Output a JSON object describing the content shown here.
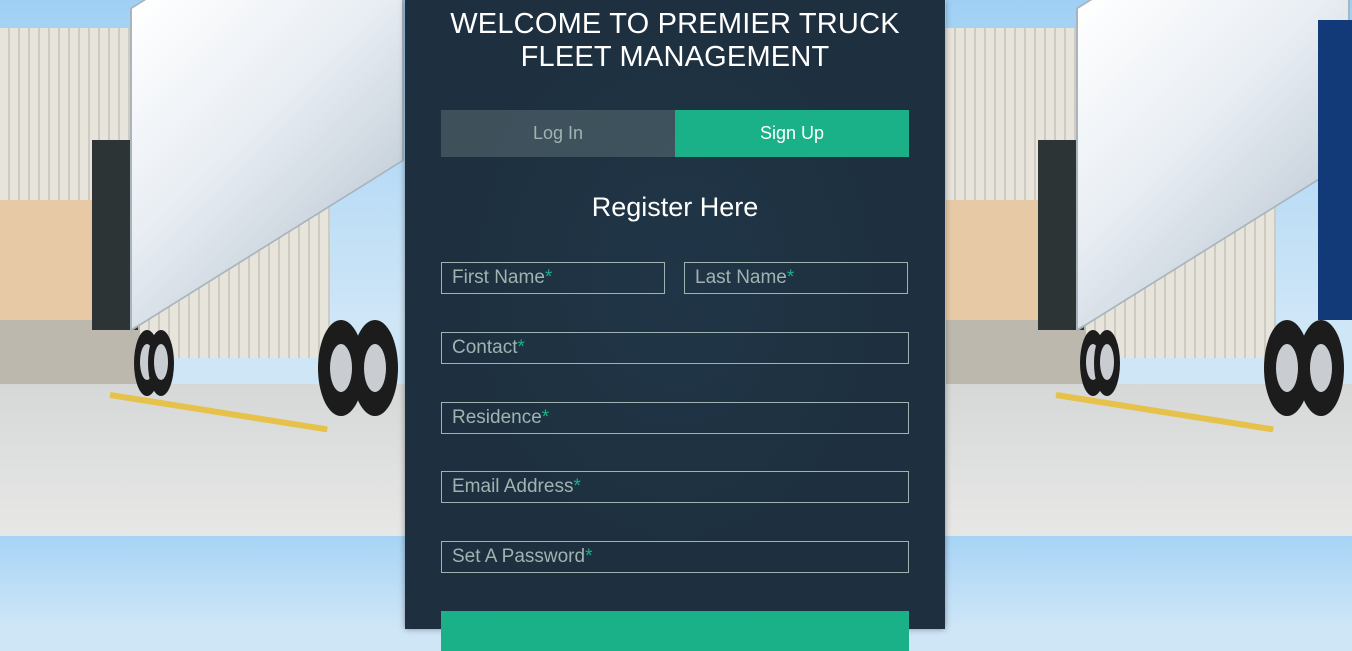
{
  "page": {
    "title": "WELCOME TO PREMIER TRUCK FLEET MANAGEMENT",
    "accent_color": "#1ab188",
    "panel_color": "#1e303e"
  },
  "tabs": [
    {
      "label": "Log In",
      "active": false
    },
    {
      "label": "Sign Up",
      "active": true
    }
  ],
  "form": {
    "heading": "Register Here",
    "required_mark": "*",
    "fields": {
      "first_name": {
        "placeholder": "First Name",
        "value": ""
      },
      "last_name": {
        "placeholder": "Last Name",
        "value": ""
      },
      "contact": {
        "placeholder": "Contact",
        "value": ""
      },
      "residence": {
        "placeholder": "Residence",
        "value": ""
      },
      "email": {
        "placeholder": "Email Address",
        "value": ""
      },
      "password": {
        "placeholder": "Set A Password",
        "value": ""
      }
    }
  },
  "background": {
    "description_icon": "truck-trailer-photo"
  }
}
